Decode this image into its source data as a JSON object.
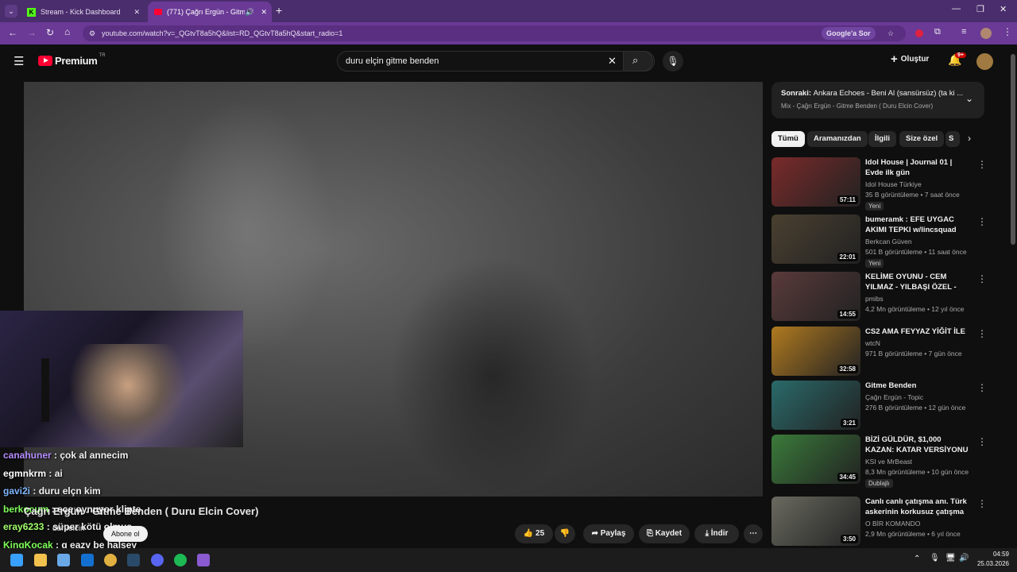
{
  "browser": {
    "tabs": [
      {
        "title": "Stream - Kick Dashboard",
        "active": false
      },
      {
        "title": "(771) Çağrı Ergün - Gitme B",
        "active": true
      }
    ],
    "url": "youtube.com/watch?v=_QGtvT8a5hQ&list=RD_QGtvT8a5hQ&start_radio=1",
    "google_ask": "Google'a Sor"
  },
  "youtube": {
    "logo": "Premium",
    "region": "TR",
    "search_query": "duru elçin gitme benden",
    "create_label": "Oluştur",
    "notification_count": "9+"
  },
  "next": {
    "label": "Sonraki:",
    "title": "Ankara Echoes - Beni Al (sansürsüz) (ta ki ...",
    "subtitle": "Mix - Çağrı Ergün - Gitme Benden ( Duru Elcin Cover)"
  },
  "chips": [
    "Tümü",
    "Aramanızdan",
    "İlgili",
    "Size özel",
    "S"
  ],
  "recommendations": [
    {
      "title": "Idol House | Journal 01 | Evde ilk gün",
      "channel": "Idol House Türkiye",
      "meta": "35 B görüntüleme • 7 saat önce",
      "badge": "Yeni",
      "duration": "57:11",
      "thumb_color": "#7a2a2a"
    },
    {
      "title": "bumeramk : EFE UYGAC AKIMI TEPKI w/lincsquad",
      "channel": "Berkcan Güven",
      "meta": "501 B görüntüleme • 11 saat önce",
      "badge": "Yeni",
      "duration": "22:01",
      "thumb_color": "#4a4030"
    },
    {
      "title": "KELİME OYUNU - CEM YILMAZ - YILBAŞI ÖZEL - Part 1",
      "channel": "pmibs",
      "meta": "4,2 Mn görüntüleme • 12 yıl önce",
      "badge": "",
      "duration": "14:55",
      "thumb_color": "#5a3a3a"
    },
    {
      "title": "CS2 AMA FEYYAZ YİĞİT İLE",
      "channel": "wtcN",
      "meta": "971 B görüntüleme • 7 gün önce",
      "badge": "",
      "duration": "32:58",
      "thumb_color": "#b07a20"
    },
    {
      "title": "Gitme Benden",
      "channel": "Çağrı Ergün - Topic",
      "meta": "276 B görüntüleme • 12 gün önce",
      "badge": "",
      "duration": "3:21",
      "thumb_color": "#2a6a6a"
    },
    {
      "title": "BİZİ GÜLDÜR, $1,000 KAZAN: KATAR VERSİYONU (ft. ...",
      "channel": "KSI ve MrBeast",
      "meta": "8,3 Mn görüntüleme • 10 gün önce",
      "badge": "Dublajlı",
      "duration": "34:45",
      "thumb_color": "#3a7a3a"
    },
    {
      "title": "Canlı canlı çatışma anı. Türk askerinin korkusuz çatışma ...",
      "channel": "O BİR KOMANDO",
      "meta": "2,9 Mn görüntüleme • 6 yıl önce",
      "badge": "",
      "duration": "3:50",
      "thumb_color": "#6a6a60"
    }
  ],
  "video": {
    "title": "Çağrı Ergün - Gitme Benden ( Duru Elcin Cover)",
    "channel_fragment": "duruelcin",
    "subscribe_label": "Abone ol",
    "likes": "25",
    "share_label": "Paylaş",
    "save_label": "Kaydet",
    "download_label": "İndir"
  },
  "chat": [
    {
      "user": "canahuner",
      "message": "çok al annecim",
      "color": "#b48cff"
    },
    {
      "user": "egmnkrm",
      "message": "ai",
      "color": "#ffffff"
    },
    {
      "user": "gavi2i",
      "message": "duru elçn kim",
      "color": "#7fb7ff"
    },
    {
      "user": "berkocum",
      "message": "ece oynuyor klipte",
      "color": "#7fff5a"
    },
    {
      "user": "eray6233",
      "message": "süper kötü olmuş",
      "color": "#a0ff6a"
    },
    {
      "user": "KingKocak",
      "message": "g eazy be halsey",
      "color": "#7fff5a"
    }
  ],
  "taskbar": {
    "time": "04:59",
    "date": "25.03.2026"
  }
}
